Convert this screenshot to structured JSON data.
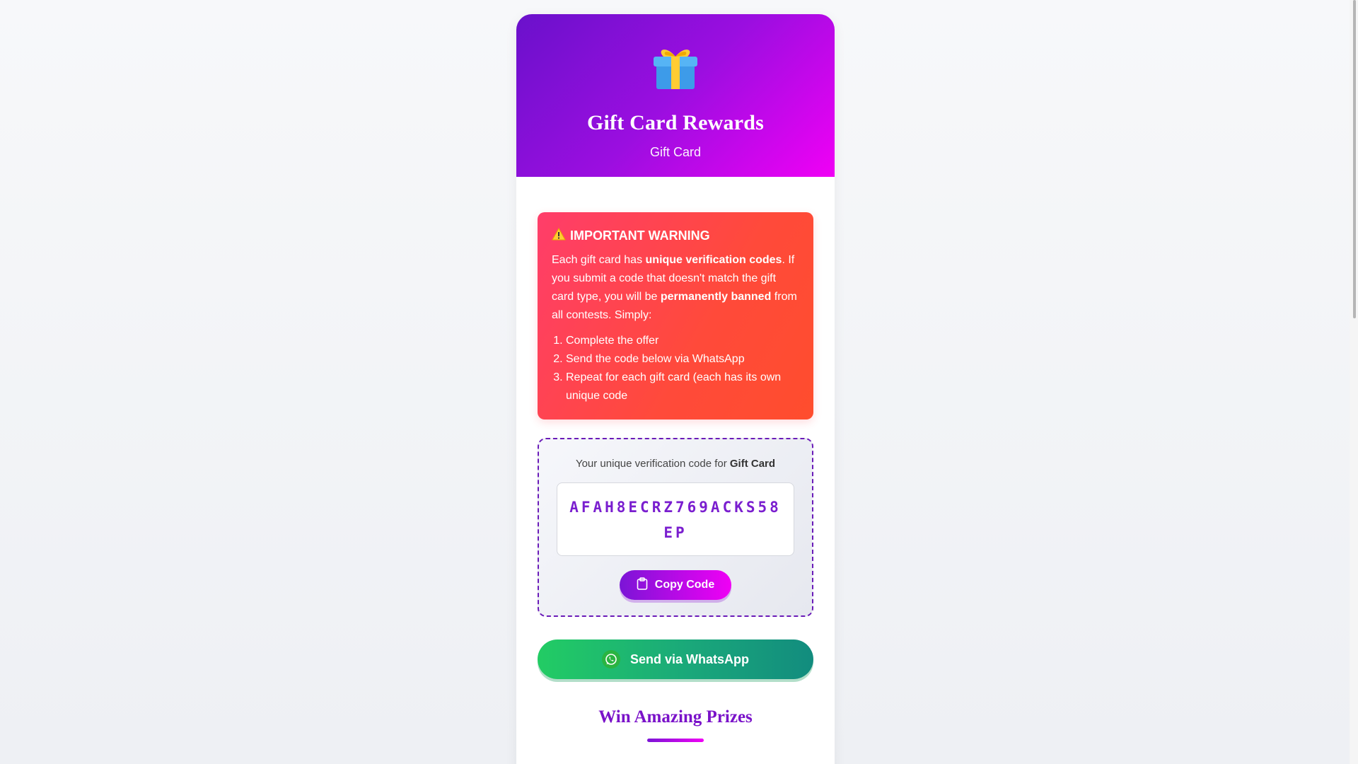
{
  "header": {
    "icon": "gift-icon",
    "title": "Gift Card Rewards",
    "subtitle": "Gift Card"
  },
  "warning": {
    "icon": "warning-icon",
    "title": "IMPORTANT WARNING",
    "text_before_bold1": "Each gift card has ",
    "bold1": "unique verification codes",
    "text_mid": ". If you submit a code that doesn't match the gift card type, you will be ",
    "bold2": "permanently banned",
    "text_after": " from all contests. Simply:",
    "steps": [
      "Complete the offer",
      "Send the code below via WhatsApp",
      "Repeat for each gift card (each has its own unique code"
    ]
  },
  "code_box": {
    "label_prefix": "Your unique verification code for ",
    "label_card": "Gift Card",
    "code": "AFAH8ECRZ769ACKS58EP",
    "copy_label": "Copy Code",
    "copy_icon": "clipboard-icon"
  },
  "whatsapp": {
    "label": "Send via WhatsApp",
    "icon": "whatsapp-icon"
  },
  "prizes": {
    "title": "Win Amazing Prizes"
  },
  "colors": {
    "header_start": "#6a11cb",
    "header_end": "#f000f5",
    "warning": "#ff4a3a",
    "code_text": "#7a1ecf",
    "whatsapp": "#22cc64"
  }
}
